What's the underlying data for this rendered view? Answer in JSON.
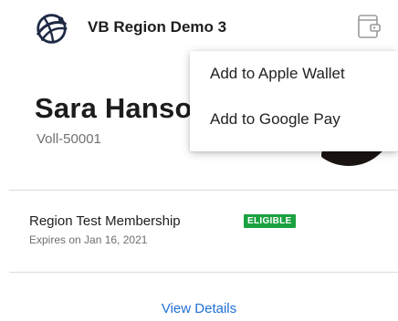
{
  "header": {
    "org_name": "VB Region Demo 3",
    "logo_icon": "globe-swoosh-logo-icon",
    "wallet_icon": "add-to-wallet-icon"
  },
  "profile": {
    "name": "Sara Hanso",
    "member_id": "Voll-50001"
  },
  "membership": {
    "title": "Region Test Membership",
    "status": "ELIGIBLE",
    "status_color": "#1aa140",
    "expiry": "Expires on Jan 16, 2021"
  },
  "actions": {
    "view_details": "View Details",
    "link_color": "#1f6fd6"
  },
  "wallet_menu": {
    "items": [
      {
        "label": "Add to Apple Wallet"
      },
      {
        "label": "Add to Google Pay"
      }
    ]
  }
}
